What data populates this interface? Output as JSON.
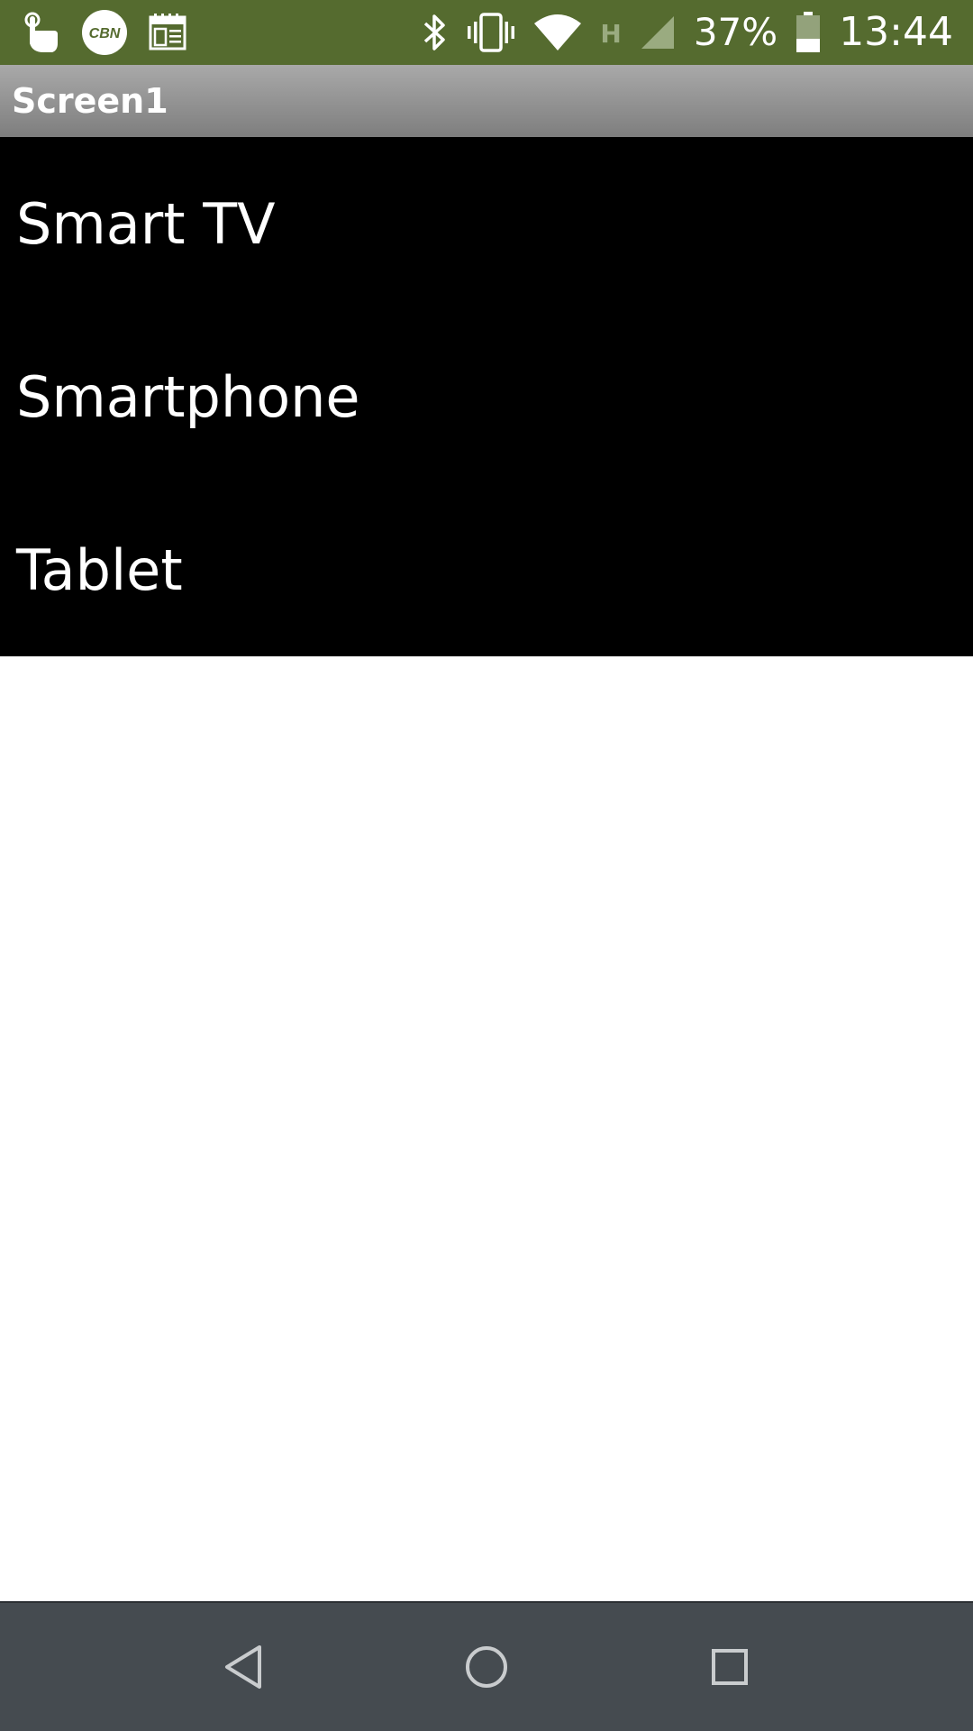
{
  "status_bar": {
    "left_icons": [
      "touch-hand-icon",
      "cbn-app-icon",
      "calendar-icon"
    ],
    "cbn_label": "CBN",
    "right_icons": [
      "bluetooth-icon",
      "vibrate-icon",
      "wifi-icon",
      "network-h-icon",
      "signal-icon",
      "battery-icon"
    ],
    "network_type": "H",
    "battery_percent": "37%",
    "battery_level": 0.37,
    "time": "13:44",
    "background_color": "#556b2f"
  },
  "title_bar": {
    "title": "Screen1"
  },
  "list": {
    "items": [
      {
        "label": "Smart TV"
      },
      {
        "label": "Smartphone"
      },
      {
        "label": "Tablet"
      }
    ]
  },
  "nav_bar": {
    "buttons": [
      "back-icon",
      "home-icon",
      "recents-icon"
    ],
    "background_color": "#454b50"
  }
}
